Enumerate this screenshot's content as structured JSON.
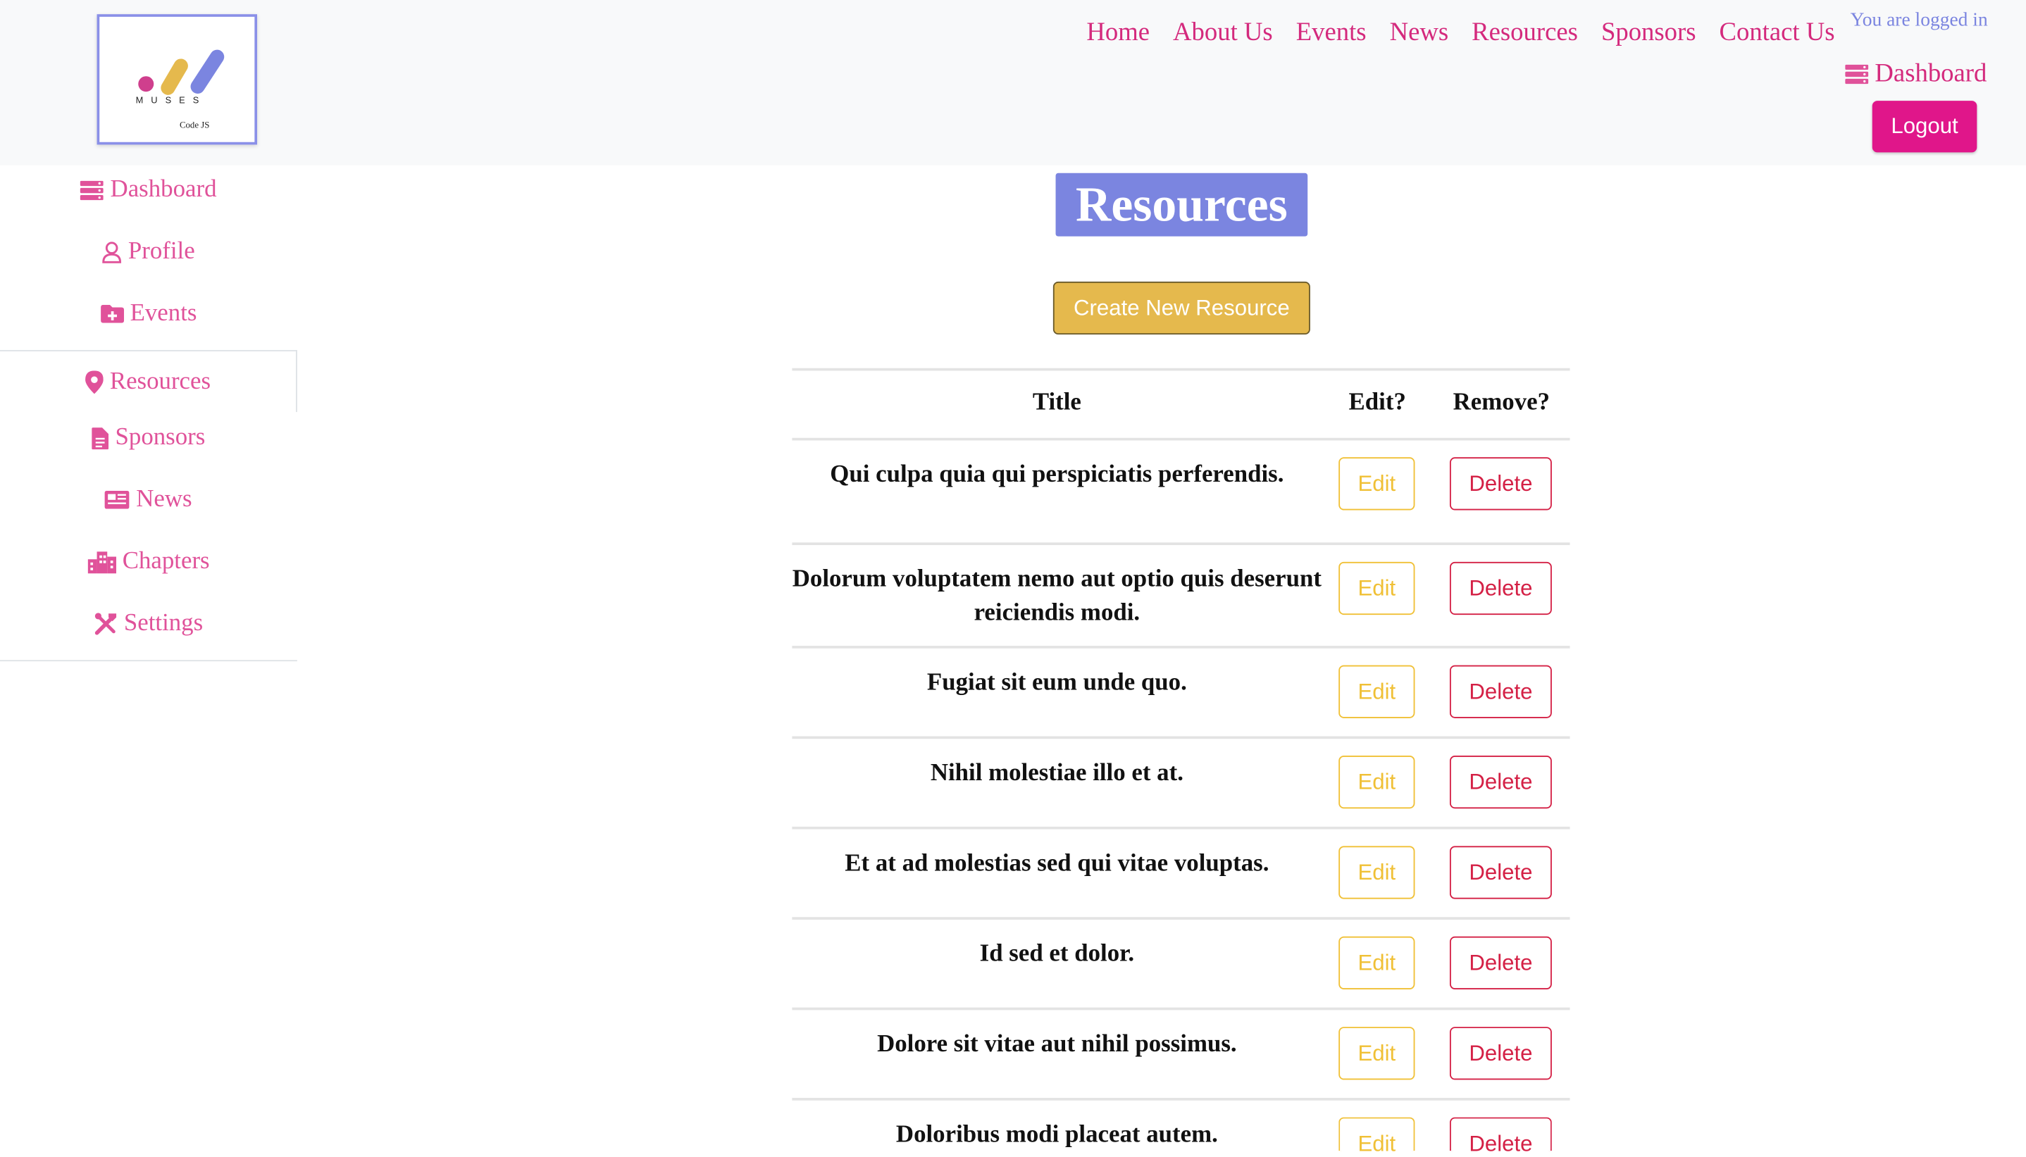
{
  "logo": {
    "wordmark": "MUSES",
    "subtitle": "Code JS",
    "colors": [
      "#cf3f8d",
      "#e5b94d",
      "#7b85e0"
    ]
  },
  "topnav": [
    "Home",
    "About Us",
    "Events",
    "News",
    "Resources",
    "Sponsors",
    "Contact Us"
  ],
  "auth": {
    "status": "You are logged in",
    "dashboard_label": "Dashboard",
    "logout_label": "Logout"
  },
  "sidebar": {
    "items": [
      {
        "label": "Dashboard",
        "icon": "server-icon"
      },
      {
        "label": "Profile",
        "icon": "user-icon"
      },
      {
        "label": "Events",
        "icon": "folder-plus-icon"
      },
      {
        "label": "Resources",
        "icon": "map-pin-icon",
        "active": true
      },
      {
        "label": "Sponsors",
        "icon": "file-icon"
      },
      {
        "label": "News",
        "icon": "newspaper-icon"
      },
      {
        "label": "Chapters",
        "icon": "city-icon"
      },
      {
        "label": "Settings",
        "icon": "tools-icon"
      }
    ]
  },
  "main": {
    "title": "Resources",
    "create_label": "Create New Resource",
    "table": {
      "headers": [
        "Title",
        "Edit?",
        "Remove?"
      ],
      "edit_label": "Edit",
      "delete_label": "Delete",
      "rows": [
        {
          "title": "Qui culpa quia qui perspiciatis perferendis."
        },
        {
          "title": "Dolorum voluptatem nemo aut optio quis deserunt reiciendis modi."
        },
        {
          "title": "Fugiat sit eum unde quo."
        },
        {
          "title": "Nihil molestiae illo et at."
        },
        {
          "title": "Et at ad molestias sed qui vitae voluptas."
        },
        {
          "title": "Id sed et dolor."
        },
        {
          "title": "Dolore sit vitae aut nihil possimus."
        },
        {
          "title": "Doloribus modi placeat autem."
        }
      ]
    }
  },
  "colors": {
    "accent": "#d42a7d",
    "primary": "#7b85e0",
    "warning": "#e5b94d",
    "danger": "#d42045"
  }
}
